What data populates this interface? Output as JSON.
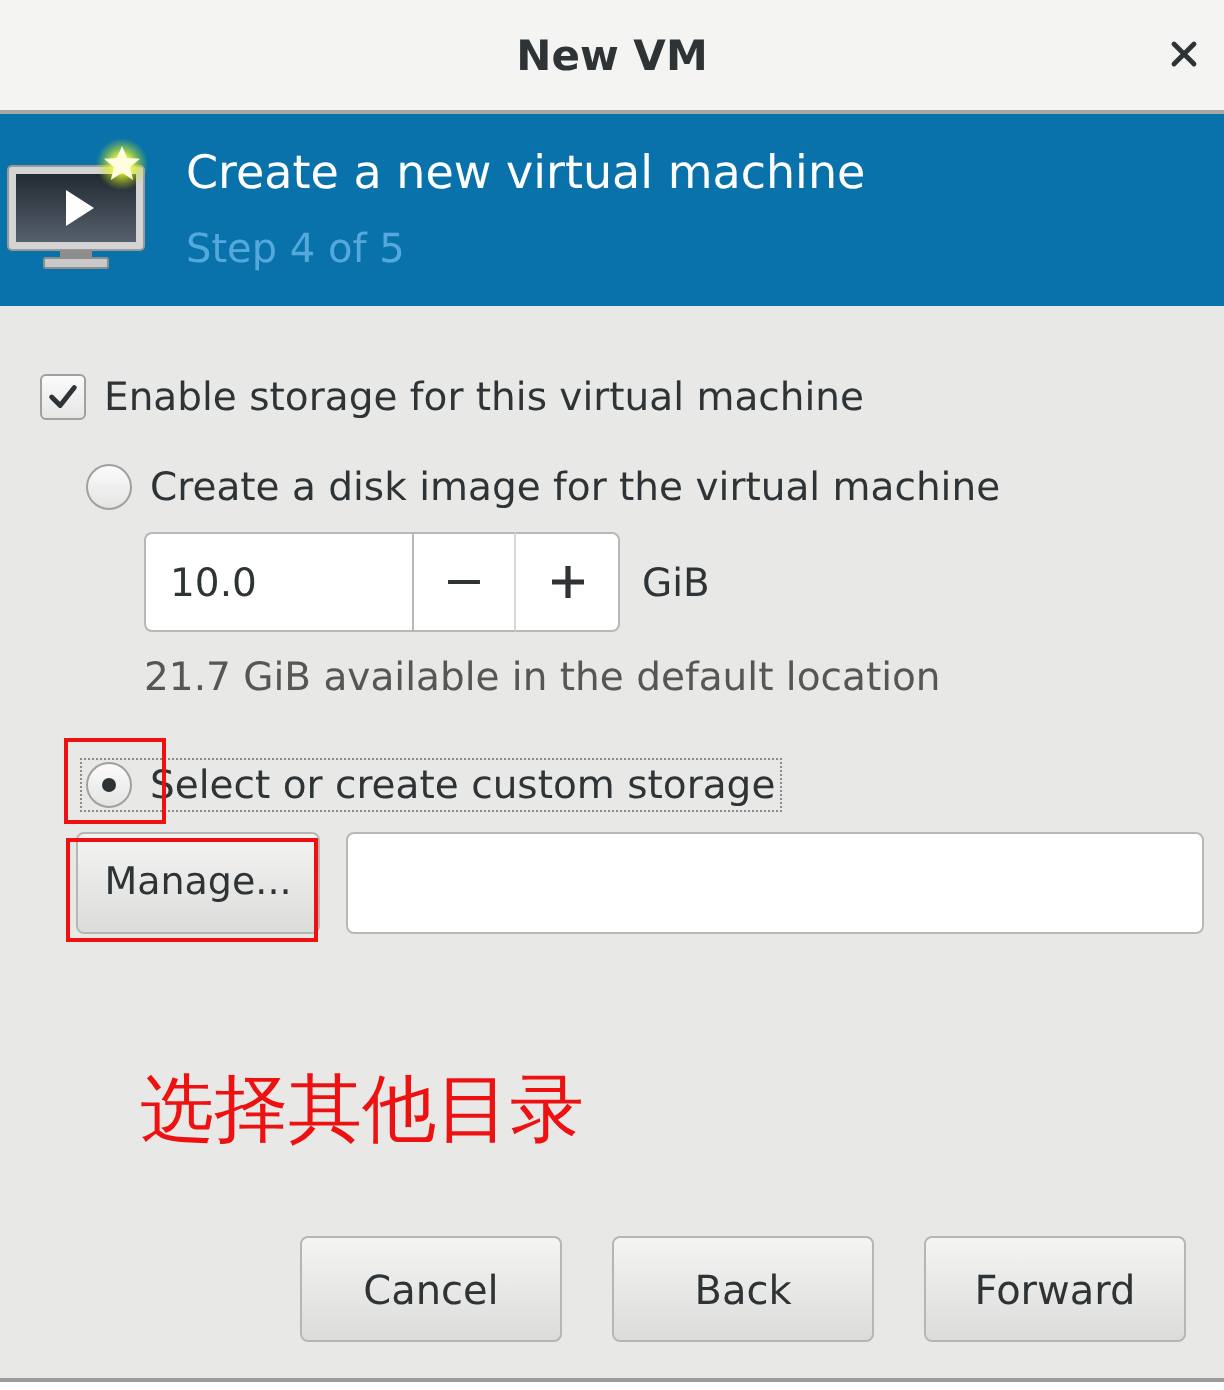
{
  "window": {
    "title": "New VM"
  },
  "header": {
    "title": "Create a new virtual machine",
    "step": "Step 4 of 5"
  },
  "storage": {
    "label": "Enable storage for this virtual machine",
    "checked": true
  },
  "storage_options": [
    {
      "kind": "disk_image",
      "label": "Create a disk image for the virtual machine",
      "selected": false,
      "focused": false,
      "highlighted": false,
      "size_value": "10.0",
      "unit": "GiB",
      "note": "21.7 GiB available in the default location"
    },
    {
      "kind": "custom",
      "label": "Select or create custom storage",
      "selected": true,
      "focused": true,
      "highlighted": true,
      "manage_button": {
        "label": "Manage...",
        "highlighted": true
      }
    }
  ],
  "annotation": {
    "text": "选择其他目录"
  },
  "buttons": [
    {
      "label": "Cancel"
    },
    {
      "label": "Back"
    },
    {
      "label": "Forward"
    }
  ]
}
